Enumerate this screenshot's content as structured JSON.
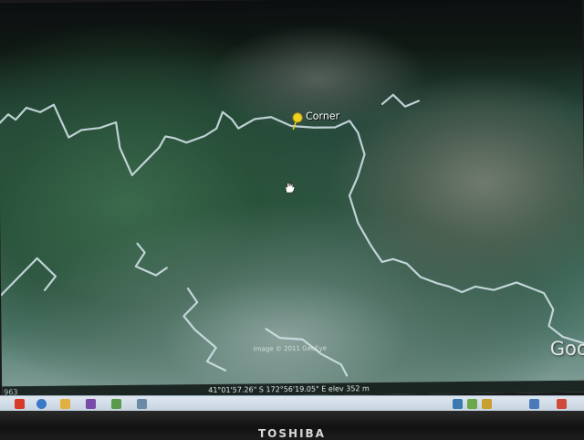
{
  "map": {
    "placemark": {
      "label": "Corner",
      "icon": "yellow-pushpin-icon",
      "color": "#f0d020"
    },
    "attribution": "Image © 2011 GeoEye",
    "logo": "Goo",
    "cursor": "hand-cursor-icon"
  },
  "status_bar": {
    "left_fragment": "963",
    "coordinates": "41°01'57.26\" S  172°56'19.05\" E  elev  352 m"
  },
  "taskbar": {
    "icons": [
      "flash-icon",
      "ie-icon",
      "folder-icon",
      "media-icon",
      "app-icon",
      "app-icon"
    ],
    "tray_icons": [
      "network-icon",
      "volume-icon",
      "shield-icon",
      "battery-icon",
      "clock-icon"
    ]
  },
  "device": {
    "brand": "TOSHIBA"
  },
  "colors": {
    "road": "#cfe0e6",
    "forest": "#2f5a47",
    "clearing": "#7a847a"
  }
}
